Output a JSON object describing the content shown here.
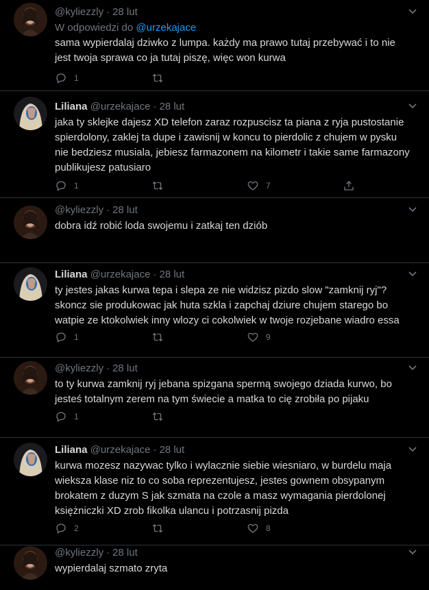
{
  "tweets": [
    {
      "author_name": "",
      "handle": "@kyliezzly",
      "time": "28 lut",
      "reply_prefix": "W odpowiedzi do",
      "reply_mention": "@urzekajace",
      "text": "sama wypierdalaj dziwko z lumpa. każdy ma prawo tutaj przebywać i to nie jest twoja sprawa co ja tutaj piszę, więc won kurwa",
      "replies": "1",
      "retweets": "",
      "likes": "",
      "show_like": false,
      "show_share": false
    },
    {
      "author_name": "Liliana",
      "handle": "@urzekajace",
      "time": "28 lut",
      "text": "jaka ty sklejke dajesz XD telefon zaraz rozpuscisz ta piana z ryja pustostanie spierdolony, zaklej ta dupe i zawisnij w koncu to pierdolic z chujem w pysku nie bedziesz musiala, jebiesz farmazonem na kilometr i takie same farmazony publikujesz patusiaro",
      "replies": "1",
      "retweets": "",
      "likes": "7",
      "show_like": true,
      "show_share": true
    },
    {
      "author_name": "",
      "handle": "@kyliezzly",
      "time": "28 lut",
      "text": "dobra idź robić loda swojemu i zatkaj ten dziób",
      "replies": "",
      "retweets": "",
      "likes": "",
      "show_like": false,
      "show_share": false
    },
    {
      "author_name": "Liliana",
      "handle": "@urzekajace",
      "time": "28 lut",
      "text": "ty jestes jakas kurwa tepa i slepa ze nie widzisz pizdo slow \"zamknij ryj\"? skoncz sie produkowac jak huta szkla i zapchaj dziure chujem starego bo watpie ze ktokolwiek inny wlozy ci cokolwiek w twoje rozjebane wiadro essa",
      "replies": "1",
      "retweets": "",
      "likes": "9",
      "show_like": true,
      "show_share": false
    },
    {
      "author_name": "",
      "handle": "@kyliezzly",
      "time": "28 lut",
      "text": "to ty kurwa zamknij ryj jebana spizgana spermą swojego dziada kurwo, bo jesteś totalnym zerem na tym świecie a matka to cię zrobiła po pijaku",
      "replies": "1",
      "retweets": "",
      "likes": "",
      "show_like": false,
      "show_share": false
    },
    {
      "author_name": "Liliana",
      "handle": "@urzekajace",
      "time": "28 lut",
      "text": "kurwa mozesz nazywac tylko i wylacznie siebie wiesniaro, w burdelu maja wieksza klase niz to co soba reprezentujesz, jestes gownem obsypanym brokatem z duzym S jak szmata na czole a masz wymagania pierdolonej księżniczki XD zrob fikolka ulancu i potrzasnij pizda",
      "replies": "2",
      "retweets": "",
      "likes": "8",
      "show_like": true,
      "show_share": false
    },
    {
      "author_name": "",
      "handle": "@kyliezzly",
      "time": "28 lut",
      "text": "wypierdalaj szmato zryta",
      "replies": "",
      "retweets": "",
      "likes": "",
      "show_like": false,
      "show_share": false
    }
  ],
  "colors": {
    "background": "#000000",
    "text": "#d9d9d9",
    "muted": "#6e767d",
    "link": "#1d9bf0",
    "divider": "#2f3336"
  },
  "icons": {
    "reply": "speech-bubble",
    "retweet": "retweet-arrows",
    "like": "heart",
    "share": "share-upload",
    "menu": "chevron-down"
  }
}
